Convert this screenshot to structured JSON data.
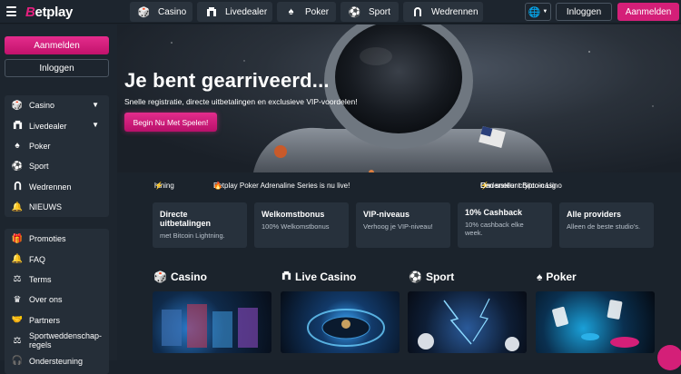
{
  "brand": {
    "logo_text": "Betplay",
    "accent": "#d41f78"
  },
  "topnav": {
    "tabs": [
      {
        "label": "Casino",
        "icon": "casino-icon"
      },
      {
        "label": "Livedealer",
        "icon": "livedealer-icon"
      },
      {
        "label": "Poker",
        "icon": "spade-icon"
      },
      {
        "label": "Sport",
        "icon": "soccer-ball-icon"
      },
      {
        "label": "Wedrennen",
        "icon": "horseshoe-icon"
      }
    ],
    "login_label": "Inloggen",
    "signup_label": "Aanmelden"
  },
  "sidebar": {
    "signup_label": "Aanmelden",
    "login_label": "Inloggen",
    "games": [
      {
        "label": "Casino",
        "icon": "casino-icon",
        "expandable": true
      },
      {
        "label": "Livedealer",
        "icon": "livedealer-icon",
        "expandable": true
      },
      {
        "label": "Poker",
        "icon": "spade-icon"
      },
      {
        "label": "Sport",
        "icon": "soccer-ball-icon"
      },
      {
        "label": "Wedrennen",
        "icon": "horseshoe-icon"
      },
      {
        "label": "NIEUWS",
        "icon": "bell-icon"
      }
    ],
    "info": [
      {
        "label": "Promoties",
        "icon": "gift-icon"
      },
      {
        "label": "FAQ",
        "icon": "bell-icon"
      },
      {
        "label": "Terms",
        "icon": "balance-scale-icon"
      },
      {
        "label": "Over ons",
        "icon": "crown-icon"
      },
      {
        "label": "Partners",
        "icon": "handshake-icon"
      },
      {
        "label": "Sportweddenschap-regels",
        "line1": "Sportweddenschap-",
        "line2": "regels",
        "icon": "balance-scale-icon"
      },
      {
        "label": "Ondersteuning",
        "icon": "headset-icon"
      }
    ]
  },
  "hero": {
    "title": "Je bent gearriveerd...",
    "subtitle": "Snelle registratie, directe uitbetalingen en exclusieve VIP-voordelen!",
    "cta": "Begin Nu Met Spelen!"
  },
  "ticker": {
    "items": [
      "htning",
      "Betplay Poker Adrenaline Series is nu live!",
      "Een sneller crypto-casino",
      "Ondersteunt Bitcoin Lig"
    ]
  },
  "features": [
    {
      "title": "Directe uitbetalingen",
      "desc": "met Bitcoin Lightning."
    },
    {
      "title": "Welkomstbonus",
      "desc": "100% Welkomstbonus"
    },
    {
      "title": "VIP-niveaus",
      "desc": "Verhoog je VIP-niveau!"
    },
    {
      "title": "10% Cashback",
      "desc": "10% cashback elke week."
    },
    {
      "title": "Alle providers",
      "desc": "Alleen de beste studio's."
    }
  ],
  "categories": [
    {
      "label": "Casino",
      "icon": "casino-icon"
    },
    {
      "label": "Live Casino",
      "icon": "livedealer-icon"
    },
    {
      "label": "Sport",
      "icon": "soccer-ball-icon"
    },
    {
      "label": "Poker",
      "icon": "spade-icon"
    }
  ]
}
